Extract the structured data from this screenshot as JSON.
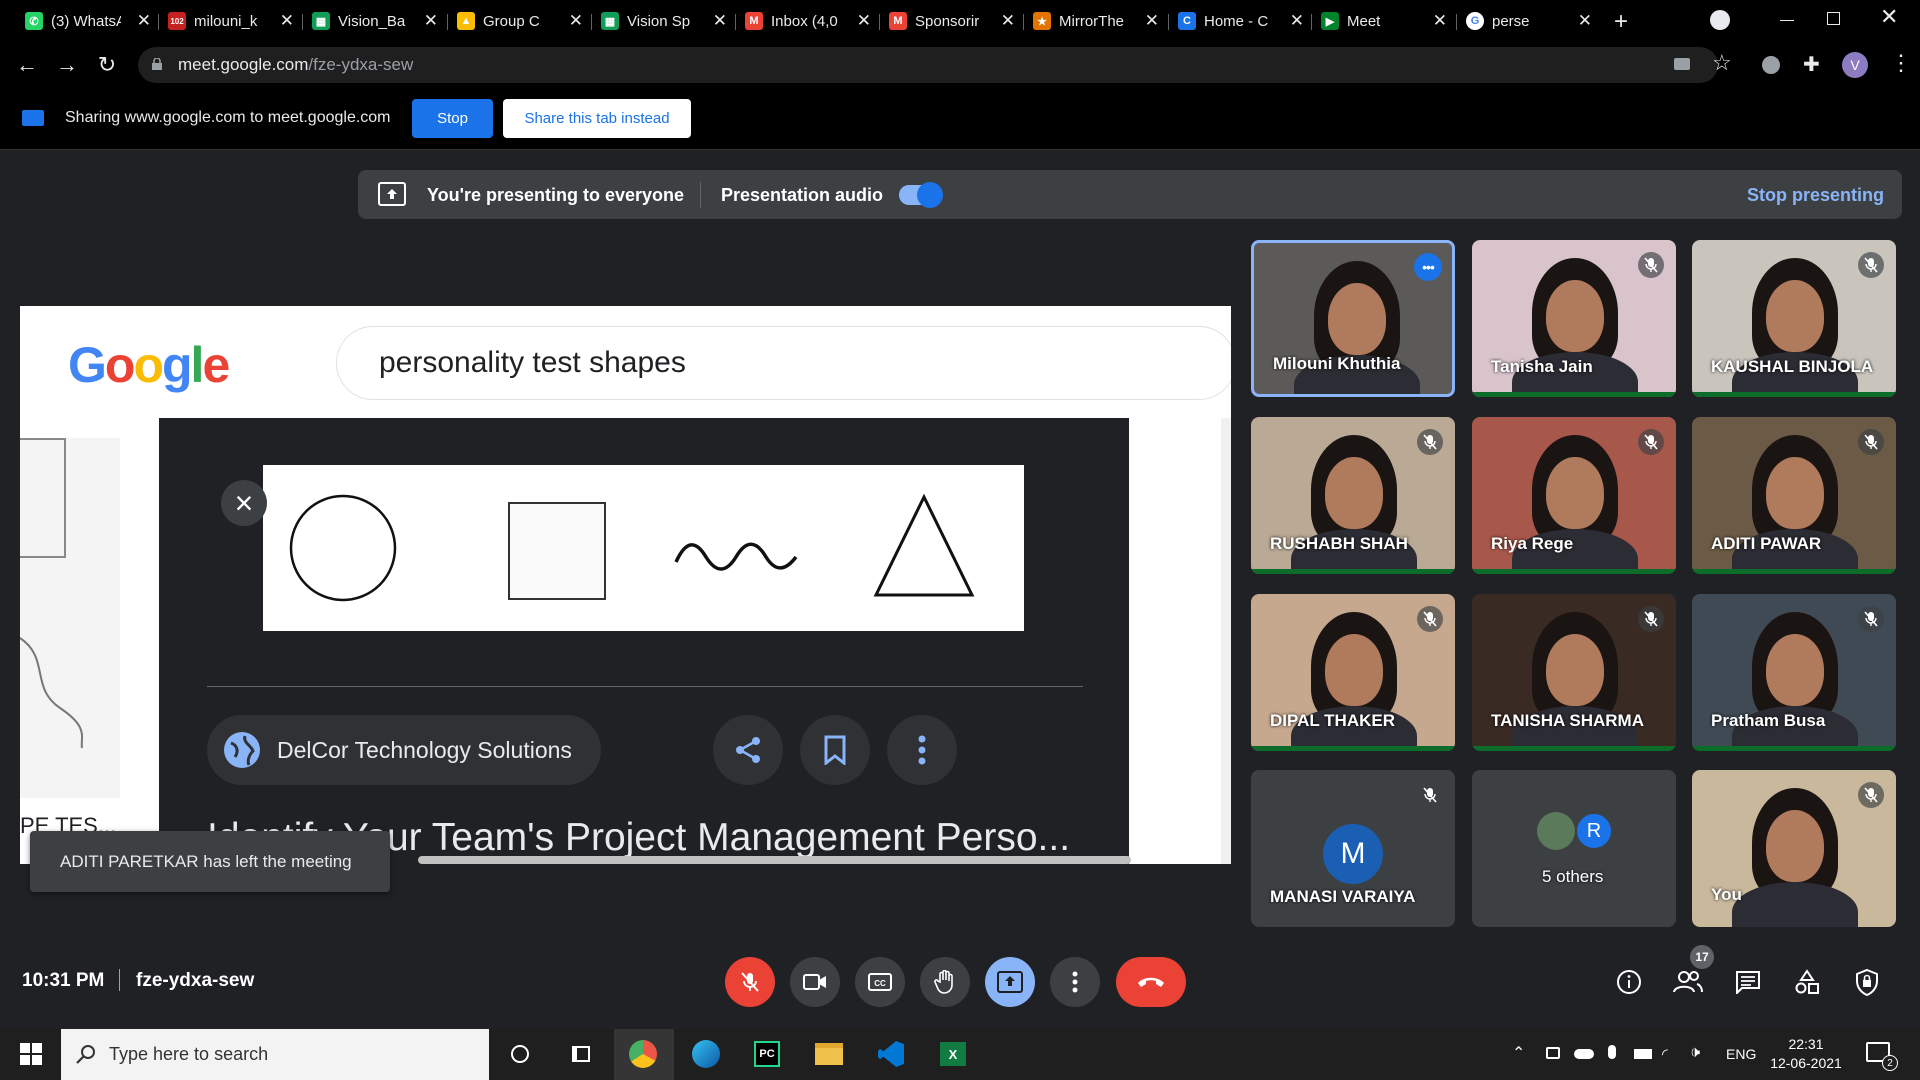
{
  "browser": {
    "tabs": [
      {
        "label": "(3) WhatsApp",
        "icon": "whatsapp-icon",
        "color": "#25d366"
      },
      {
        "label": "milouni_k",
        "icon": "badge-icon",
        "color": "#c5221f"
      },
      {
        "label": "Vision_Ba",
        "icon": "sheets-icon",
        "color": "#0f9d58"
      },
      {
        "label": "Group C",
        "icon": "drive-icon",
        "color": "#fbbc04"
      },
      {
        "label": "Vision Sp",
        "icon": "sheets-icon",
        "color": "#0f9d58"
      },
      {
        "label": "Inbox (4,0",
        "icon": "gmail-icon",
        "color": "#ea4335"
      },
      {
        "label": "Sponsorir",
        "icon": "gmail-icon",
        "color": "#ea4335"
      },
      {
        "label": "MirrorThe",
        "icon": "star-icon",
        "color": "#e37400"
      },
      {
        "label": "Home - C",
        "icon": "c-icon",
        "color": "#1a73e8"
      },
      {
        "label": "Meet",
        "icon": "meet-icon",
        "color": "#00832d"
      },
      {
        "label": "perse",
        "icon": "google-icon",
        "color": "#ffffff"
      }
    ],
    "url_host": "meet.google.com",
    "url_path": "/fze-ydxa-sew",
    "profile_initial": "V"
  },
  "share_bar": {
    "message": "Sharing www.google.com to meet.google.com",
    "stop_label": "Stop",
    "share_tab_label": "Share this tab instead"
  },
  "presenting": {
    "status": "You're presenting to everyone",
    "audio_label": "Presentation audio",
    "audio_on": true,
    "stop_label": "Stop presenting"
  },
  "shared_screen": {
    "search_query": "personality test shapes",
    "cropped_left_text": "PE TES...",
    "source_name": "DelCor Technology Solutions",
    "result_title": "Identify Your Team's Project Management Perso..."
  },
  "toast": {
    "message": "ADITI PARETKAR has left the meeting"
  },
  "participants": [
    {
      "name": "Milouni Khuthia",
      "muted": false,
      "active": true,
      "bg": "#5b5a58"
    },
    {
      "name": "Tanisha Jain",
      "muted": true,
      "active": false,
      "bg": "#d9c4cc"
    },
    {
      "name": "KAUSHAL BINJOLA",
      "muted": true,
      "active": false,
      "bg": "#c9c4bc"
    },
    {
      "name": "RUSHABH SHAH",
      "muted": true,
      "active": false,
      "bg": "#b9a995"
    },
    {
      "name": "Riya Rege",
      "muted": true,
      "active": false,
      "bg": "#a8584a"
    },
    {
      "name": "ADITI PAWAR",
      "muted": true,
      "active": false,
      "bg": "#6b5a45"
    },
    {
      "name": "DIPAL THAKER",
      "muted": true,
      "active": false,
      "bg": "#c6a88f"
    },
    {
      "name": "TANISHA SHARMA",
      "muted": true,
      "active": false,
      "bg": "#3a2a24"
    },
    {
      "name": "Pratham Busa",
      "muted": true,
      "active": false,
      "bg": "#3f4a55"
    },
    {
      "name": "MANASI VARAIYA",
      "muted": true,
      "active": false,
      "bg": "#3c4043",
      "initial": "M"
    },
    {
      "name": "5 others",
      "muted": false,
      "active": false,
      "bg": "#3c4043",
      "initial": "R"
    },
    {
      "name": "You",
      "muted": true,
      "active": false,
      "bg": "#c9b89c"
    }
  ],
  "meet_bar": {
    "time": "10:31 PM",
    "meeting_code": "fze-ydxa-sew",
    "participant_count": "17"
  },
  "taskbar": {
    "search_placeholder": "Type here to search",
    "lang": "ENG",
    "time": "22:31",
    "date": "12-06-2021",
    "notification_count": "2"
  },
  "colors": {
    "meet_bg": "#202124",
    "accent_blue": "#8ab4f8",
    "end_call_red": "#ea4335"
  }
}
